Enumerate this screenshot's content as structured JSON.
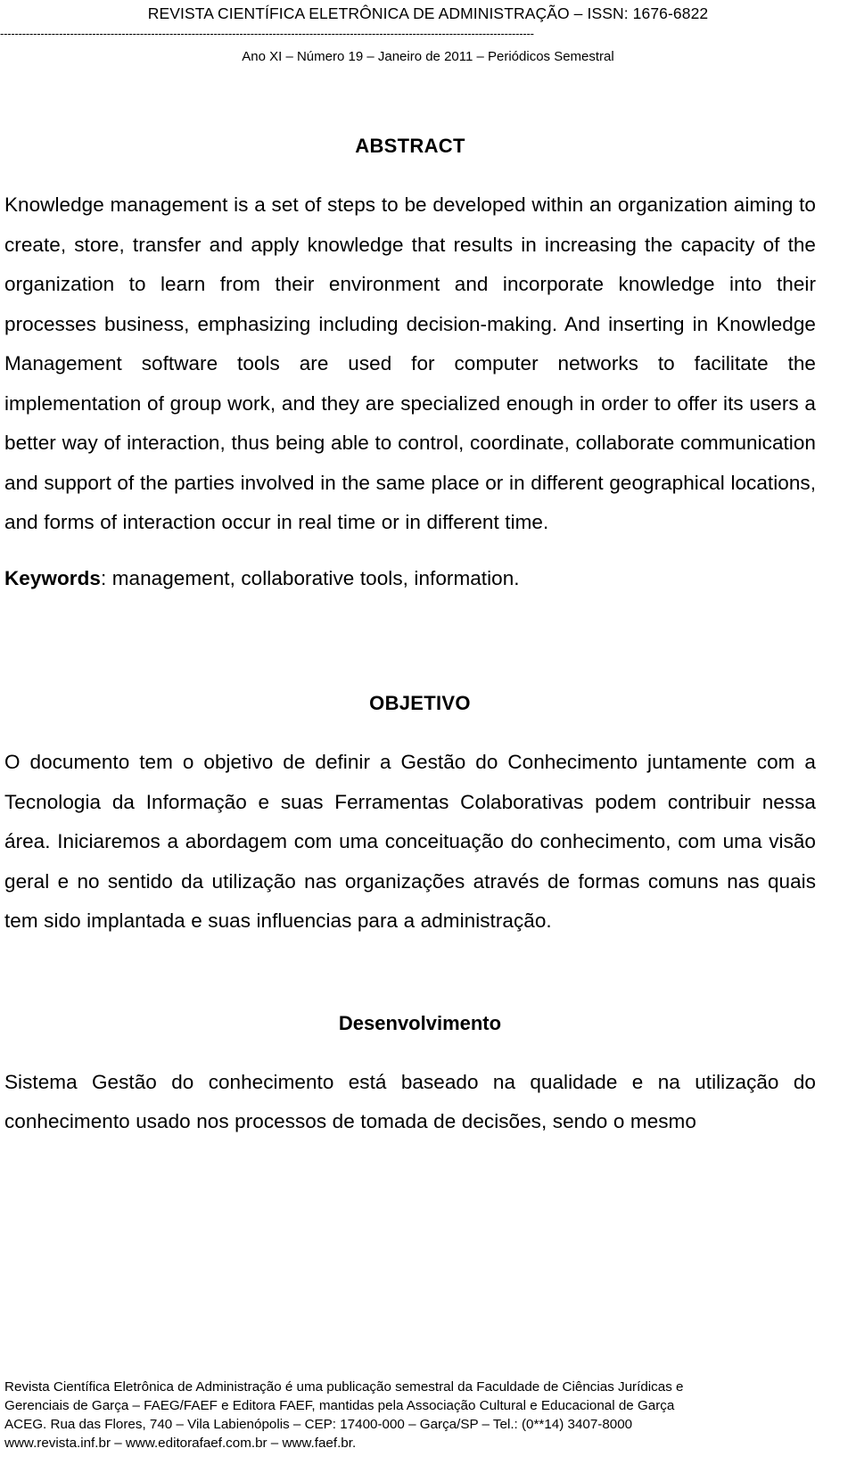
{
  "masthead": {
    "journal_title": "REVISTA CIENTÍFICA ELETRÔNICA DE ADMINISTRAÇÃO – ISSN: 1676-6822",
    "divider": "-------------------------------------------------------------------------------------------------------------------------------------------------",
    "issue_line": "Ano XI – Número 19 – Janeiro de 2011 – Periódicos Semestral"
  },
  "abstract": {
    "heading": "ABSTRACT",
    "paragraph": "Knowledge management is a set of steps to be developed within an organization aiming to create, store, transfer and apply knowledge that results in increasing the capacity of the organization to learn from their environment and incorporate knowledge into their processes business, emphasizing including decision-making. And inserting in Knowledge Management software tools are used for computer networks to facilitate the implementation of group work, and they are specialized enough in order to offer its users a better way of interaction, thus being able to control, coordinate, collaborate communication and support of the parties involved in the same place or in different geographical locations, and forms of interaction occur in real time or in different time.",
    "keywords_label": "Keywords",
    "keywords_value": ": management, collaborative tools, information."
  },
  "objetivo": {
    "heading": "OBJETIVO",
    "paragraph": "O documento tem o objetivo de definir a Gestão do Conhecimento juntamente com a Tecnologia da Informação e suas Ferramentas Colaborativas podem contribuir nessa área. Iniciaremos a abordagem com uma conceituação do conhecimento, com uma visão geral e no sentido da utilização nas organizações através de formas comuns nas quais tem sido implantada e suas influencias para a administração."
  },
  "desenvolvimento": {
    "heading": "Desenvolvimento",
    "paragraph": "Sistema Gestão do conhecimento está baseado na qualidade e na utilização do conhecimento usado nos processos de tomada de decisões, sendo o mesmo"
  },
  "footer": {
    "line1": "Revista Científica Eletrônica de Administração é uma publicação semestral da Faculdade de Ciências Jurídicas e",
    "line2": "Gerenciais de Garça – FAEG/FAEF e Editora FAEF, mantidas pela Associação Cultural e Educacional de Garça",
    "line3": "ACEG. Rua das Flores, 740 – Vila Labienópolis – CEP: 17400-000 – Garça/SP – Tel.: (0**14) 3407-8000",
    "line4": "www.revista.inf.br – www.editorafaef.com.br – www.faef.br."
  }
}
